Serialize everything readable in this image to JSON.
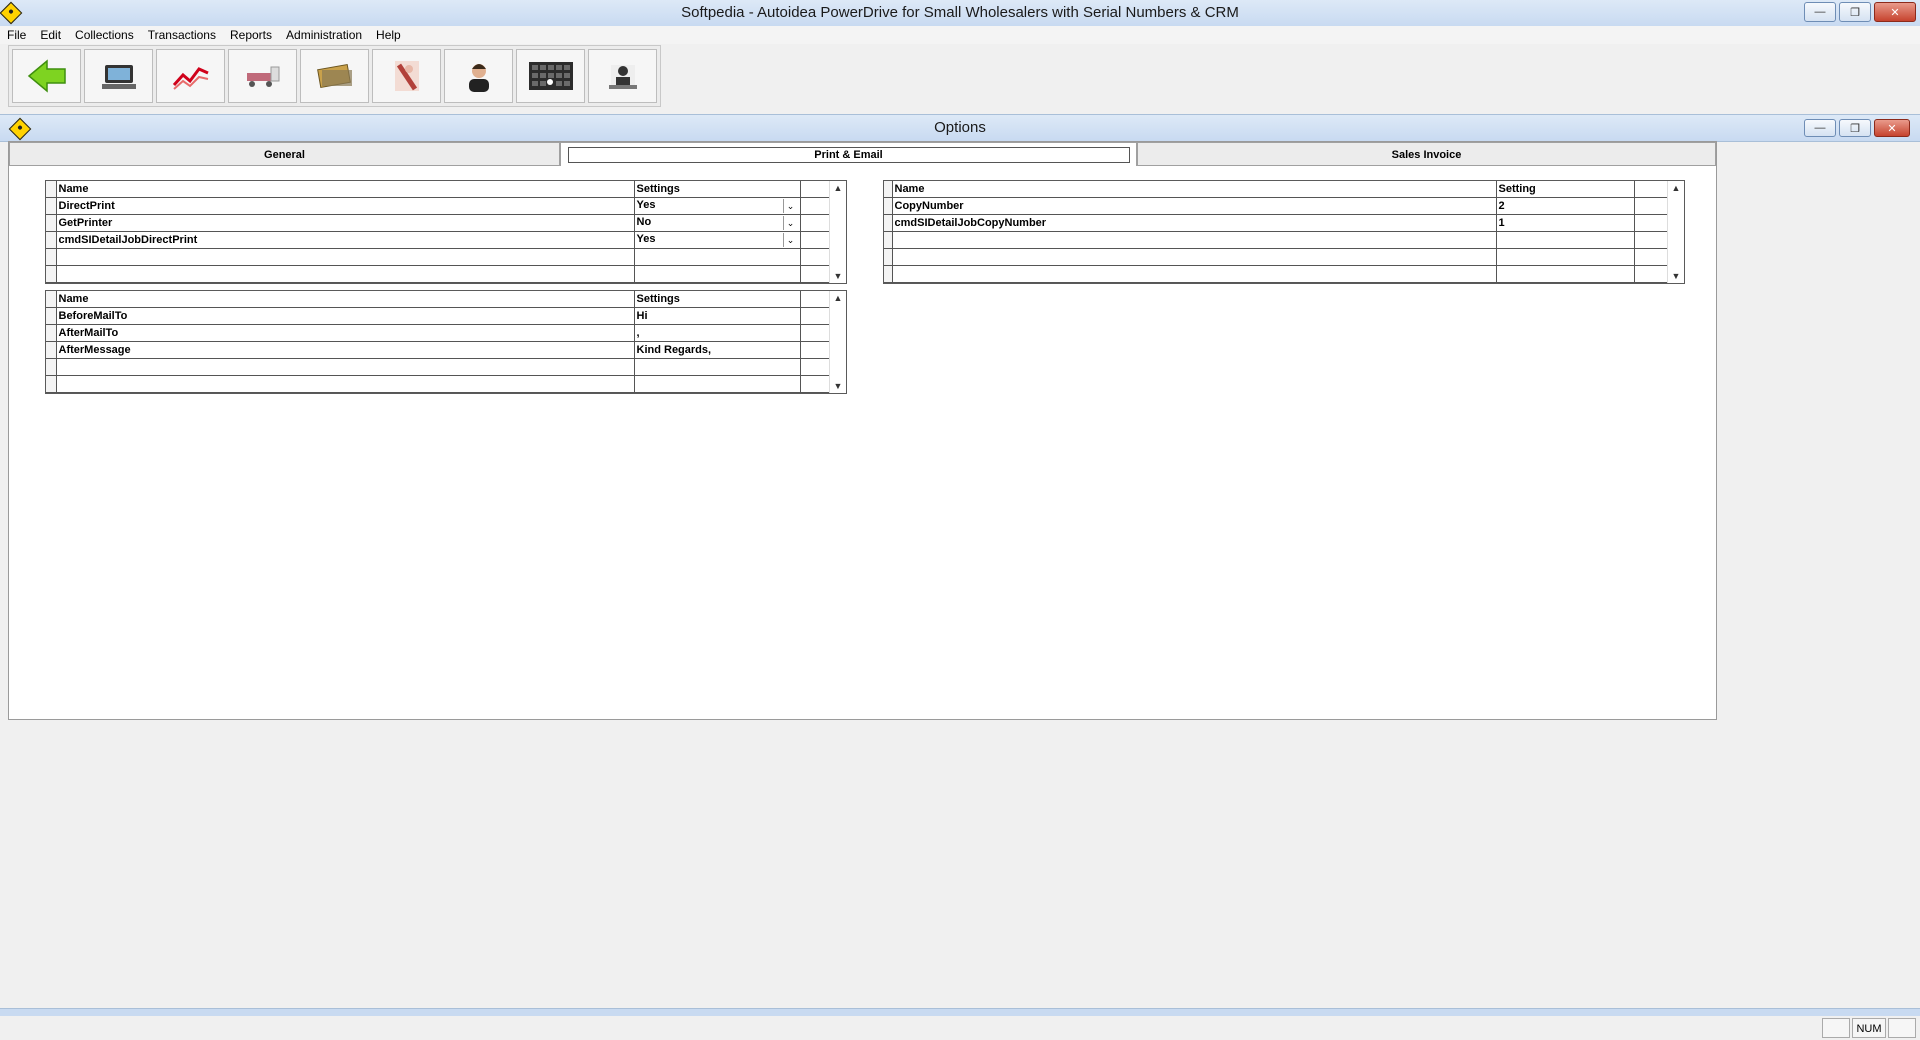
{
  "window": {
    "title": "Softpedia - Autoidea PowerDrive for Small Wholesalers with Serial Numbers & CRM",
    "min": "—",
    "restore": "❐",
    "close": "✕"
  },
  "menu": [
    "File",
    "Edit",
    "Collections",
    "Transactions",
    "Reports",
    "Administration",
    "Help"
  ],
  "toolbar": {
    "buttons": [
      "back-arrow-icon",
      "pos-terminal-icon",
      "sales-chart-icon",
      "delivery-truck-icon",
      "cash-icon",
      "woman-icon",
      "support-agent-icon",
      "keyboard-icon",
      "administrator-icon"
    ]
  },
  "child_window": {
    "title": "Options"
  },
  "tabs": [
    "General",
    "Print & Email",
    "Sales Invoice"
  ],
  "print_grid": {
    "headers": [
      "Name",
      "Settings"
    ],
    "rows": [
      {
        "name": "DirectPrint",
        "value": "Yes"
      },
      {
        "name": "GetPrinter",
        "value": "No"
      },
      {
        "name": "cmdSIDetailJobDirectPrint",
        "value": "Yes"
      }
    ]
  },
  "email_grid": {
    "headers": [
      "Name",
      "Settings"
    ],
    "rows": [
      {
        "name": "BeforeMailTo",
        "value": "Hi"
      },
      {
        "name": "AfterMailTo",
        "value": ","
      },
      {
        "name": "AfterMessage",
        "value": "Kind Regards,"
      }
    ]
  },
  "copies_grid": {
    "headers": [
      "Name",
      "Setting"
    ],
    "rows": [
      {
        "name": "CopyNumber",
        "value": "2"
      },
      {
        "name": "cmdSIDetailJobCopyNumber",
        "value": "1"
      }
    ]
  },
  "status": {
    "num": "NUM"
  },
  "colors": {
    "titlebar": "#c8daf1",
    "close_button": "#c6432e",
    "app_icon": "#ffd200"
  }
}
